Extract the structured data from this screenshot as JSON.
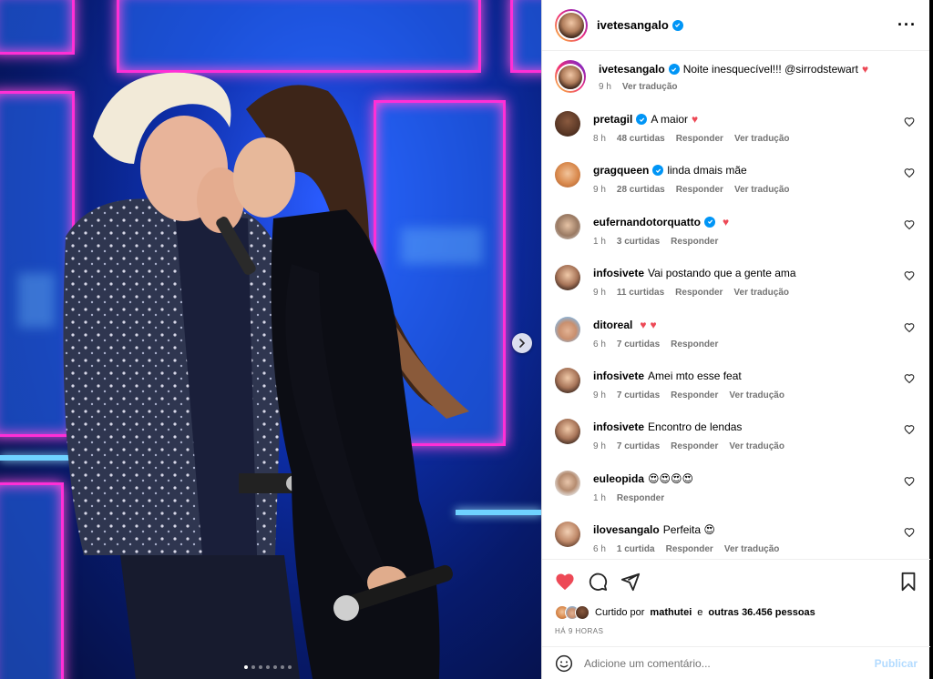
{
  "post": {
    "carousel": {
      "total_slides": 7,
      "active_index": 0
    }
  },
  "header": {
    "username": "ivetesangalo",
    "more_icon": "more-horizontal-icon"
  },
  "caption": {
    "username": "ivetesangalo",
    "text": "Noite inesquecível!!! @sirrodstewart",
    "time": "9 h",
    "translate": "Ver tradução"
  },
  "comments": [
    {
      "username": "pretagil",
      "verified": true,
      "text": "A maior",
      "hearts": 1,
      "time": "8 h",
      "likes": "48 curtidas",
      "reply": "Responder",
      "translate": "Ver tradução"
    },
    {
      "username": "gragqueen",
      "verified": true,
      "text": "linda dmais mãe",
      "hearts": 0,
      "time": "9 h",
      "likes": "28 curtidas",
      "reply": "Responder",
      "translate": "Ver tradução"
    },
    {
      "username": "eufernandotorquatto",
      "verified": true,
      "text": "",
      "hearts": 1,
      "time": "1 h",
      "likes": "3 curtidas",
      "reply": "Responder",
      "translate": ""
    },
    {
      "username": "infosivete",
      "verified": false,
      "text": "Vai postando que a gente ama",
      "hearts": 0,
      "time": "9 h",
      "likes": "11 curtidas",
      "reply": "Responder",
      "translate": "Ver tradução"
    },
    {
      "username": "ditoreal",
      "verified": false,
      "text": "",
      "hearts": 2,
      "time": "6 h",
      "likes": "7 curtidas",
      "reply": "Responder",
      "translate": ""
    },
    {
      "username": "infosivete",
      "verified": false,
      "text": "Amei mto esse feat",
      "hearts": 0,
      "time": "9 h",
      "likes": "7 curtidas",
      "reply": "Responder",
      "translate": "Ver tradução"
    },
    {
      "username": "infosivete",
      "verified": false,
      "text": "Encontro de lendas",
      "hearts": 0,
      "time": "9 h",
      "likes": "7 curtidas",
      "reply": "Responder",
      "translate": "Ver tradução"
    },
    {
      "username": "euleopida",
      "verified": false,
      "text": "😍😍😍😍",
      "hearts": 0,
      "time": "1 h",
      "likes": "",
      "reply": "Responder",
      "translate": ""
    },
    {
      "username": "ilovesangalo",
      "verified": false,
      "text": "Perfeita 😍",
      "hearts": 0,
      "time": "6 h",
      "likes": "1 curtida",
      "reply": "Responder",
      "translate": "Ver tradução"
    }
  ],
  "actions": {
    "liked": true,
    "likes_prefix": "Curtido por",
    "likes_user": "mathutei",
    "likes_suffix_connector": "e",
    "likes_others": "outras 36.456 pessoas",
    "time_ago": "HÁ 9 HORAS"
  },
  "comment_box": {
    "placeholder": "Adicione um comentário...",
    "publish": "Publicar"
  },
  "colors": {
    "heart": "#ed4956",
    "verified": "#0095f6",
    "publish_disabled": "#b3dbff",
    "muted_text": "#737373"
  }
}
